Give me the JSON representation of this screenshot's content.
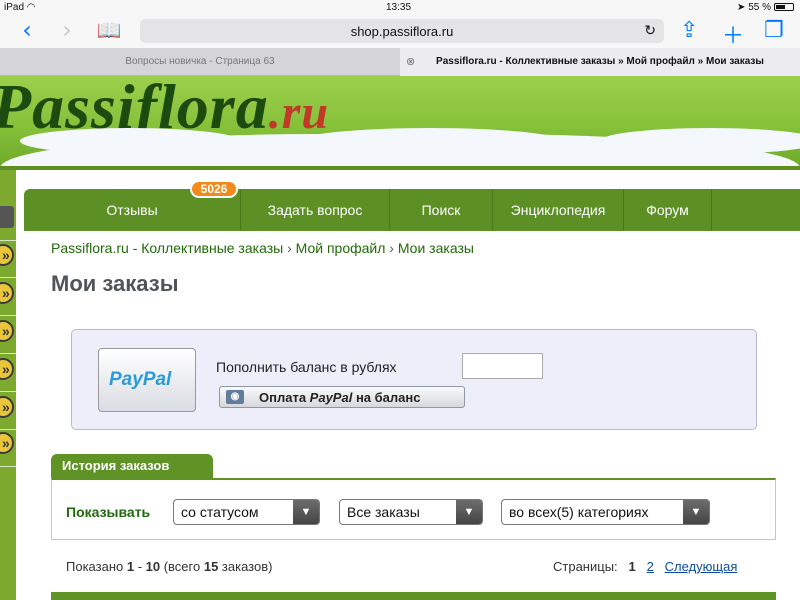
{
  "status_bar": {
    "device": "iPad",
    "time": "13:35",
    "battery": "55 %"
  },
  "browser": {
    "url": "shop.passiflora.ru",
    "tabs": [
      {
        "title": "Вопросы новичка - Страница 63"
      },
      {
        "title": "Passiflora.ru - Коллективные заказы » Мой профайл » Мои заказы"
      }
    ],
    "icons": [
      "back-icon",
      "forward-icon",
      "bookmarks-icon",
      "reload-icon",
      "share-icon",
      "new-tab-icon",
      "tabs-icon"
    ]
  },
  "site": {
    "logo": "Passiflora.ru",
    "menu": [
      {
        "label": "Отзывы",
        "badge": "5026"
      },
      {
        "label": "Задать вопрос"
      },
      {
        "label": "Поиск"
      },
      {
        "label": "Энциклопедия"
      },
      {
        "label": "Форум"
      }
    ],
    "breadcrumb": [
      "Passiflora.ru - Коллективные заказы",
      "Мой профайл",
      "Мои заказы"
    ],
    "breadcrumb_sep": "›",
    "page_title": "Мои заказы"
  },
  "payment": {
    "card_logo_a": "Pay",
    "card_logo_b": "Pal",
    "label": "Пополнить баланс в рублях",
    "amount": "",
    "button_pre": "Оплата ",
    "button_brand": "PayPal",
    "button_post": " на баланс"
  },
  "history": {
    "tab": "История заказов",
    "show_label": "Показывать",
    "filters": [
      {
        "value": "со статусом"
      },
      {
        "value": "Все заказы"
      },
      {
        "value": "во всех(5) категориях"
      }
    ],
    "shown_prefix": "Показано ",
    "from": "1",
    "dash": " - ",
    "to": "10",
    "total_text": " (всего ",
    "total": "15",
    "unit": " заказов)",
    "pages_label": "Страницы:",
    "current_page": "1",
    "page_2": "2",
    "next": "Следующая"
  }
}
